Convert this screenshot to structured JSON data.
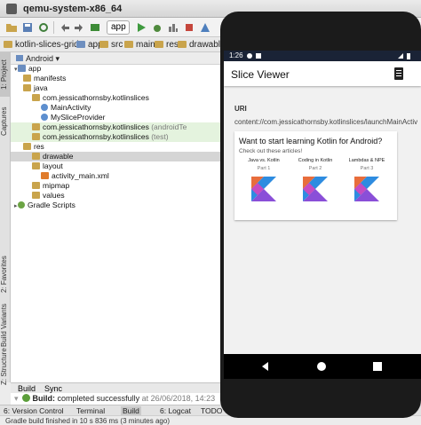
{
  "window": {
    "title": "qemu-system-x86_64"
  },
  "toolbar": {
    "run_config": "app"
  },
  "breadcrumbs": [
    "kotlin-slices-grid",
    "app",
    "src",
    "main",
    "res",
    "drawable"
  ],
  "project_panel": {
    "view": "Android",
    "tree": [
      {
        "label": "app",
        "indent": 0,
        "icon": "folder"
      },
      {
        "label": "manifests",
        "indent": 1,
        "icon": "folder"
      },
      {
        "label": "java",
        "indent": 1,
        "icon": "folder"
      },
      {
        "label": "com.jessicathornsby.kotlinslices",
        "indent": 2,
        "icon": "folder"
      },
      {
        "label": "MainActivity",
        "indent": 3,
        "icon": "class"
      },
      {
        "label": "MySliceProvider",
        "indent": 3,
        "icon": "class"
      },
      {
        "label": "com.jessicathornsby.kotlinslices",
        "suffix": "(androidTe",
        "indent": 2,
        "icon": "folder"
      },
      {
        "label": "com.jessicathornsby.kotlinslices",
        "suffix": "(test)",
        "indent": 2,
        "icon": "folder"
      },
      {
        "label": "res",
        "indent": 1,
        "icon": "folder"
      },
      {
        "label": "drawable",
        "indent": 2,
        "icon": "folder"
      },
      {
        "label": "layout",
        "indent": 2,
        "icon": "folder"
      },
      {
        "label": "activity_main.xml",
        "indent": 3,
        "icon": "xml"
      },
      {
        "label": "mipmap",
        "indent": 2,
        "icon": "folder"
      },
      {
        "label": "values",
        "indent": 2,
        "icon": "folder"
      },
      {
        "label": "Gradle Scripts",
        "indent": 0,
        "icon": "gradle"
      }
    ]
  },
  "left_tabs": [
    "1: Project",
    "Captures",
    "2: Favorites",
    "Build Variants",
    "Z: Structure"
  ],
  "editor": {
    "tab": "drawable"
  },
  "build_panel": {
    "tabs": [
      "Build",
      "Sync"
    ],
    "message_prefix": "Build:",
    "message": "completed successfully",
    "timestamp": "at 26/06/2018, 14:23"
  },
  "bottom_tools": [
    "6: Version Control",
    "Terminal",
    "Build",
    "6: Logcat",
    "TODO"
  ],
  "status": "Gradle build finished in 10 s 836 ms (3 minutes ago)",
  "phone": {
    "time": "1:26",
    "app_title": "Slice Viewer",
    "uri_label": "URI",
    "uri_value": "content://com.jessicathornsby.kotlinslices/launchMainActivit",
    "card": {
      "heading": "Want to start learning Kotlin for Android?",
      "sub": "Check out these articles!",
      "items": [
        {
          "title": "Java vs. Kotlin",
          "part": "Part 1"
        },
        {
          "title": "Coding in Kotlin",
          "part": "Part 2"
        },
        {
          "title": "Lambdas & NPE",
          "part": "Part 3"
        }
      ]
    }
  }
}
